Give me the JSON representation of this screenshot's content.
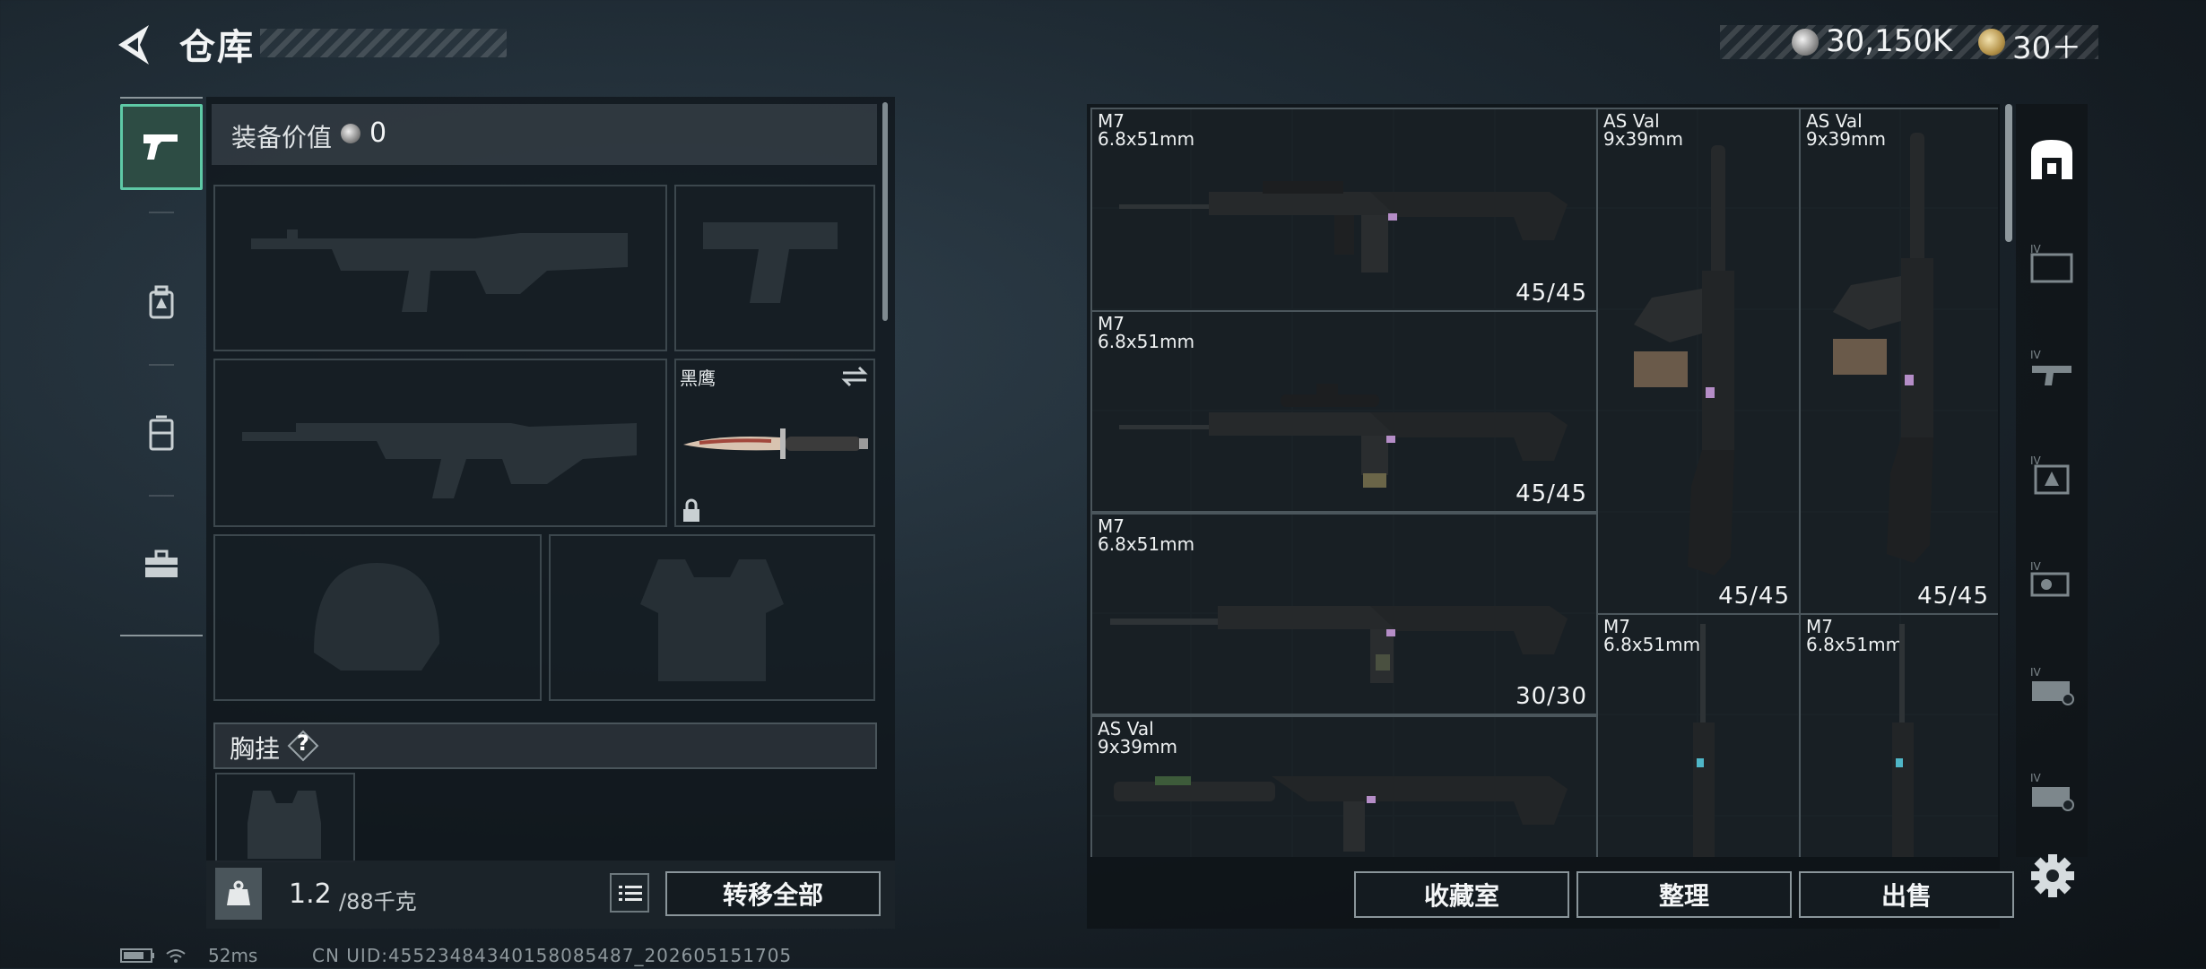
{
  "header": {
    "title": "仓库"
  },
  "currency": {
    "silver": "30,150K",
    "gold": "30＋"
  },
  "nav": [
    {
      "icon": "pistol-icon",
      "active": true
    },
    {
      "icon": "backpack-icon",
      "active": false
    },
    {
      "icon": "rig-icon",
      "active": false
    },
    {
      "icon": "toolbox-icon",
      "active": false
    }
  ],
  "loadout": {
    "value_label": "装备价值",
    "value": "0",
    "knife_name": "黑鹰",
    "chest_label": "胸挂",
    "chest_help": "?"
  },
  "weight": {
    "current": "1.2",
    "max": "/88千克"
  },
  "actions": {
    "transfer_all": "转移全部",
    "collection": "收藏室",
    "sort": "整理",
    "sell": "出售"
  },
  "stash": {
    "items": [
      {
        "name": "M7",
        "caliber": "6.8x51mm",
        "ammo": "45/45"
      },
      {
        "name": "M7",
        "caliber": "6.8x51mm",
        "ammo": "45/45"
      },
      {
        "name": "M7",
        "caliber": "6.8x51mm",
        "ammo": "30/30"
      },
      {
        "name": "AS Val",
        "caliber": "9x39mm",
        "ammo": ""
      },
      {
        "name": "AS Val",
        "caliber": "9x39mm",
        "ammo": "45/45"
      },
      {
        "name": "AS Val",
        "caliber": "9x39mm",
        "ammo": "45/45"
      },
      {
        "name": "M7",
        "caliber": "6.8x51mm",
        "ammo": ""
      },
      {
        "name": "M7",
        "caliber": "6.8x51mm",
        "ammo": ""
      }
    ]
  },
  "status": {
    "ping": "52ms",
    "uid": "CN UID:4552348434015808548​7_202605151705"
  }
}
